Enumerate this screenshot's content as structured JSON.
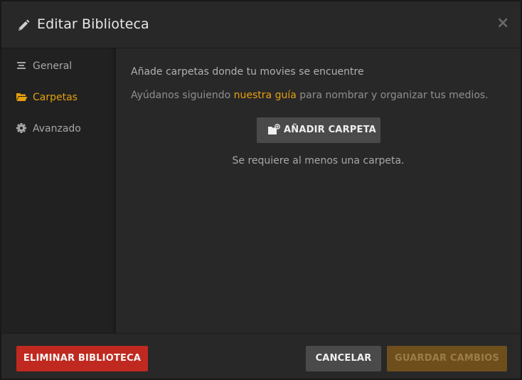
{
  "header": {
    "title": "Editar Biblioteca",
    "close_glyph": "×",
    "icon": "pencil-icon"
  },
  "sidebar": {
    "items": [
      {
        "label": "General",
        "icon": "list-icon",
        "active": false
      },
      {
        "label": "Carpetas",
        "icon": "folder-icon",
        "active": true
      },
      {
        "label": "Avanzado",
        "icon": "gear-icon",
        "active": false
      }
    ]
  },
  "main": {
    "description": "Añade carpetas donde tu movies se encuentre",
    "help_prefix": "Ayúdanos siguiendo ",
    "help_link": "nuestra guía",
    "help_suffix": " para nombrar y organizar tus medios.",
    "add_folder_label": "AÑADIR CARPETA",
    "requirement_note": "Se requiere al menos una carpeta."
  },
  "footer": {
    "delete_label": "ELIMINAR BIBLIOTECA",
    "cancel_label": "CANCELAR",
    "save_label": "GUARDAR CAMBIOS"
  },
  "colors": {
    "accent": "#e5a00d",
    "danger": "#c0291f",
    "background": "#282828",
    "sidebar": "#212121"
  }
}
